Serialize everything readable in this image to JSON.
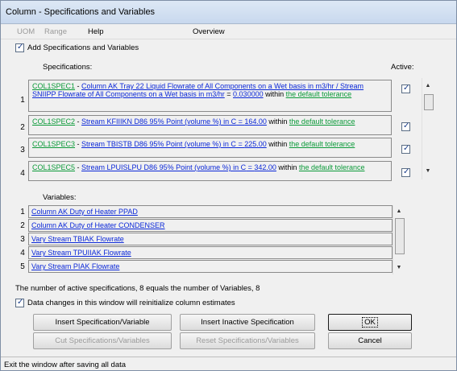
{
  "window": {
    "title": "Column - Specifications and Variables"
  },
  "menu": [
    {
      "label": "UOM",
      "enabled": false
    },
    {
      "label": "Range",
      "enabled": false
    },
    {
      "label": "Help",
      "enabled": true
    },
    {
      "label": "Overview",
      "enabled": true
    }
  ],
  "add_specs": {
    "label": "Add Specifications and Variables",
    "checked": true
  },
  "specifications": {
    "header": "Specifications:",
    "active_header": "Active:",
    "rows": [
      {
        "num": "1",
        "id": "COL1SPEC1",
        "sep": " - ",
        "desc": "Column AK Tray 22 Liquid Flowrate of All Components on a Wet basis in m3/hr",
        "op": " / ",
        "desc2": "Stream SNIIPP Flowrate of All Components on a Wet basis in m3/hr",
        "eq": " = ",
        "value": "0.030000",
        "within": " within ",
        "tol": "the default tolerance",
        "active": true
      },
      {
        "num": "2",
        "id": "COL1SPEC2",
        "sep": " - ",
        "desc": "Stream KFIIIKN D86 95% Point (volume %) in C",
        "eq": " = ",
        "value": "164.00",
        "within": " within ",
        "tol": "the default tolerance",
        "active": true
      },
      {
        "num": "3",
        "id": "COL1SPEC3",
        "sep": " - ",
        "desc": "Stream TBISTB D86 95% Point (volume %) in C",
        "eq": " = ",
        "value": "225.00",
        "within": " within ",
        "tol": "the default tolerance",
        "active": true
      },
      {
        "num": "4",
        "id": "COL1SPEC5",
        "sep": " - ",
        "desc": "Stream LPUISLPU D86 95% Point (volume %) in C",
        "eq": " = ",
        "value": "342.00",
        "within": " within ",
        "tol": "the default tolerance",
        "active": true
      }
    ]
  },
  "variables": {
    "header": "Variables:",
    "rows": [
      {
        "num": "1",
        "label": "Column AK Duty of Heater PPAD"
      },
      {
        "num": "2",
        "label": "Column AK Duty of Heater CONDENSER"
      },
      {
        "num": "3",
        "label": "Vary Stream TBIAK Flowrate"
      },
      {
        "num": "4",
        "label": "Vary Stream TPUIIAK Flowrate"
      },
      {
        "num": "5",
        "label": "Vary Stream PIAK Flowrate"
      }
    ]
  },
  "status_message": "The number of active specifications, 8 equals the number of Variables, 8",
  "reinit": {
    "label": "Data changes in this window will reinitialize column estimates",
    "checked": true
  },
  "buttons": {
    "insert_spec_var": "Insert Specification/Variable",
    "insert_inactive": "Insert Inactive Specification",
    "ok": "OK",
    "cut": "Cut Specifications/Variables",
    "reset": "Reset Specifications/Variables",
    "cancel": "Cancel"
  },
  "statusbar": {
    "text": "Exit the window after saving all data"
  },
  "colors": {
    "link_blue": "#0b28d8",
    "link_green": "#0b9a39",
    "title_bg": "#c8d8ee"
  }
}
